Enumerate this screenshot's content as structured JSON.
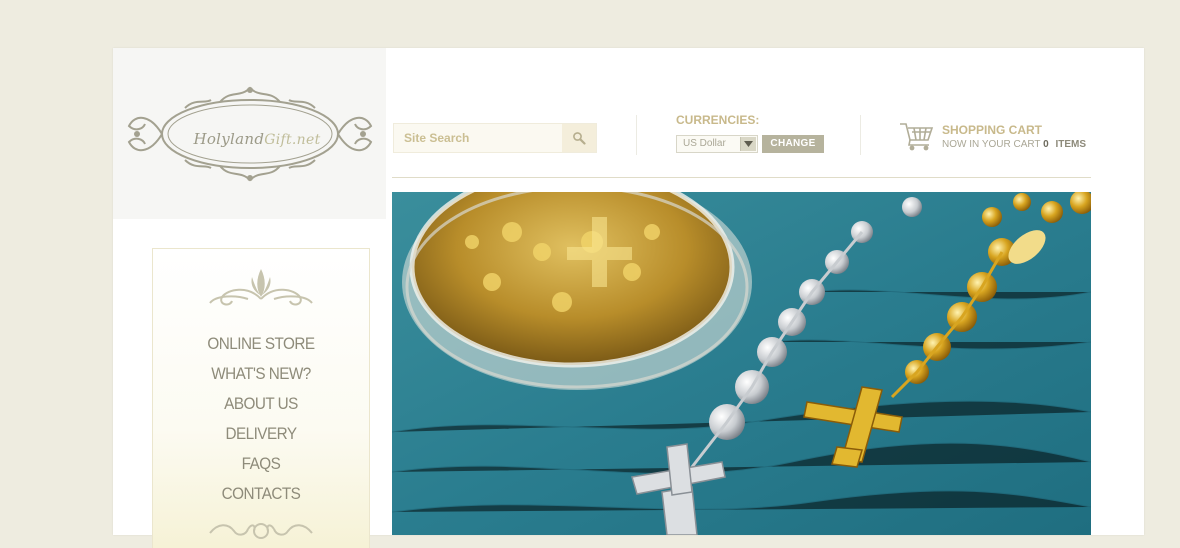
{
  "logo": {
    "text_main": "Holyland",
    "text_accent": "Gift.net"
  },
  "search": {
    "placeholder": "Site Search"
  },
  "currency": {
    "label": "CURRENCIES:",
    "selected": "US Dollar",
    "change_label": "CHANGE"
  },
  "cart": {
    "title": "SHOPPING CART",
    "line_prefix": "NOW IN YOUR CART",
    "count": "0",
    "items_label": "ITEMS"
  },
  "nav": {
    "items": [
      {
        "label": "ONLINE STORE"
      },
      {
        "label": "WHAT'S NEW?"
      },
      {
        "label": "ABOUT US"
      },
      {
        "label": "DELIVERY"
      },
      {
        "label": "FAQS"
      },
      {
        "label": "CONTACTS"
      }
    ]
  },
  "icons": [
    "search-icon",
    "cart-icon",
    "chevron-down-icon"
  ],
  "colors": {
    "gold": "#c8b98b",
    "teal": "#2b8394",
    "grey_text": "#8e8b7a"
  }
}
